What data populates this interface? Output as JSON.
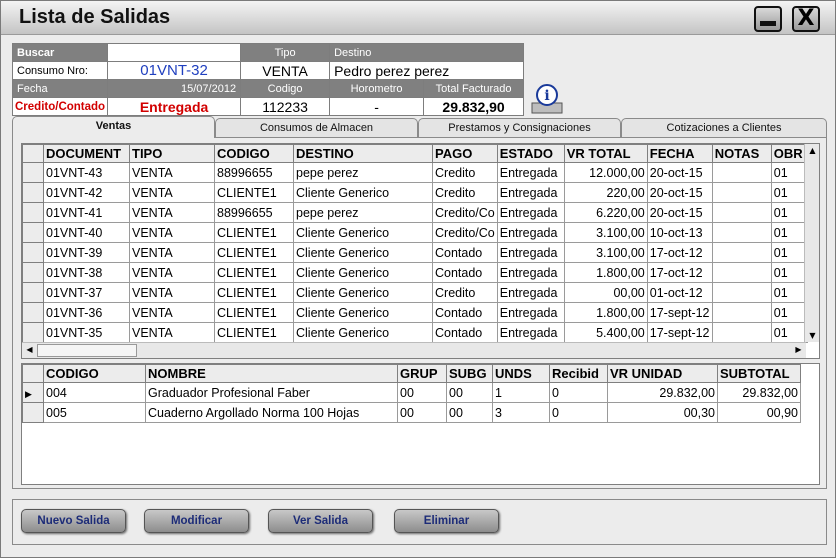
{
  "window": {
    "title": "Lista de Salidas",
    "minimize_icon": "minimize-icon",
    "close_label": "X"
  },
  "header": {
    "buscar_label": "Buscar",
    "buscar_value": "",
    "tipo_label": "Tipo",
    "destino_label": "Destino",
    "consumo_label": "Consumo Nro:",
    "consumo_value": "01VNT-32",
    "tipo_value": "VENTA",
    "destino_value": "Pedro perez perez",
    "fecha_label": "Fecha",
    "fecha_value": "15/07/2012",
    "codigo_label": "Codigo",
    "horometro_label": "Horometro",
    "total_label": "Total Facturado",
    "credito_label": "Credito/Contado",
    "estado_value": "Entregada",
    "codigo_value": "112233",
    "horometro_value": "-",
    "total_value": "29.832,90"
  },
  "tabs": [
    "Ventas",
    "Consumos de Almacen",
    "Prestamos y Consignaciones",
    "Cotizaciones a Clientes"
  ],
  "salidas": {
    "columns": [
      "DOCUMENT",
      "TIPO",
      "CODIGO",
      "DESTINO",
      "PAGO",
      "ESTADO",
      "VR TOTAL",
      "FECHA",
      "NOTAS",
      "OBR"
    ],
    "rows": [
      [
        "01VNT-43",
        "VENTA",
        "88996655",
        "pepe perez",
        "Credito",
        "Entregada",
        "12.000,00",
        "20-oct-15",
        "",
        "01"
      ],
      [
        "01VNT-42",
        "VENTA",
        "CLIENTE1",
        "Cliente Generico",
        "Credito",
        "Entregada",
        "220,00",
        "20-oct-15",
        "",
        "01"
      ],
      [
        "01VNT-41",
        "VENTA",
        "88996655",
        "pepe perez",
        "Credito/Co",
        "Entregada",
        "6.220,00",
        "20-oct-15",
        "",
        "01"
      ],
      [
        "01VNT-40",
        "VENTA",
        "CLIENTE1",
        "Cliente Generico",
        "Credito/Co",
        "Entregada",
        "3.100,00",
        "10-oct-13",
        "",
        "01"
      ],
      [
        "01VNT-39",
        "VENTA",
        "CLIENTE1",
        "Cliente Generico",
        "Contado",
        "Entregada",
        "3.100,00",
        "17-oct-12",
        "",
        "01"
      ],
      [
        "01VNT-38",
        "VENTA",
        "CLIENTE1",
        "Cliente Generico",
        "Contado",
        "Entregada",
        "1.800,00",
        "17-oct-12",
        "",
        "01"
      ],
      [
        "01VNT-37",
        "VENTA",
        "CLIENTE1",
        "Cliente Generico",
        "Credito",
        "Entregada",
        "00,00",
        "01-oct-12",
        "",
        "01"
      ],
      [
        "01VNT-36",
        "VENTA",
        "CLIENTE1",
        "Cliente Generico",
        "Contado",
        "Entregada",
        "1.800,00",
        "17-sept-12",
        "",
        "01"
      ],
      [
        "01VNT-35",
        "VENTA",
        "CLIENTE1",
        "Cliente Generico",
        "Contado",
        "Entregada",
        "5.400,00",
        "17-sept-12",
        "",
        "01"
      ]
    ]
  },
  "items": {
    "columns": [
      "CODIGO",
      "NOMBRE",
      "GRUP",
      "SUBG",
      "UNDS",
      "Recibid",
      "VR UNIDAD",
      "SUBTOTAL"
    ],
    "rows": [
      [
        "004",
        "Graduador Profesional Faber",
        "00",
        "00",
        "1",
        "0",
        "29.832,00",
        "29.832,00"
      ],
      [
        "005",
        "Cuaderno Argollado Norma 100 Hojas",
        "00",
        "00",
        "3",
        "0",
        "00,30",
        "00,90"
      ]
    ]
  },
  "buttons": {
    "nuevo": "Nuevo Salida",
    "modificar": "Modificar",
    "ver": "Ver Salida",
    "eliminar": "Eliminar"
  },
  "icons": {
    "info": "info-icon",
    "row_pointer": "row-pointer-icon"
  }
}
